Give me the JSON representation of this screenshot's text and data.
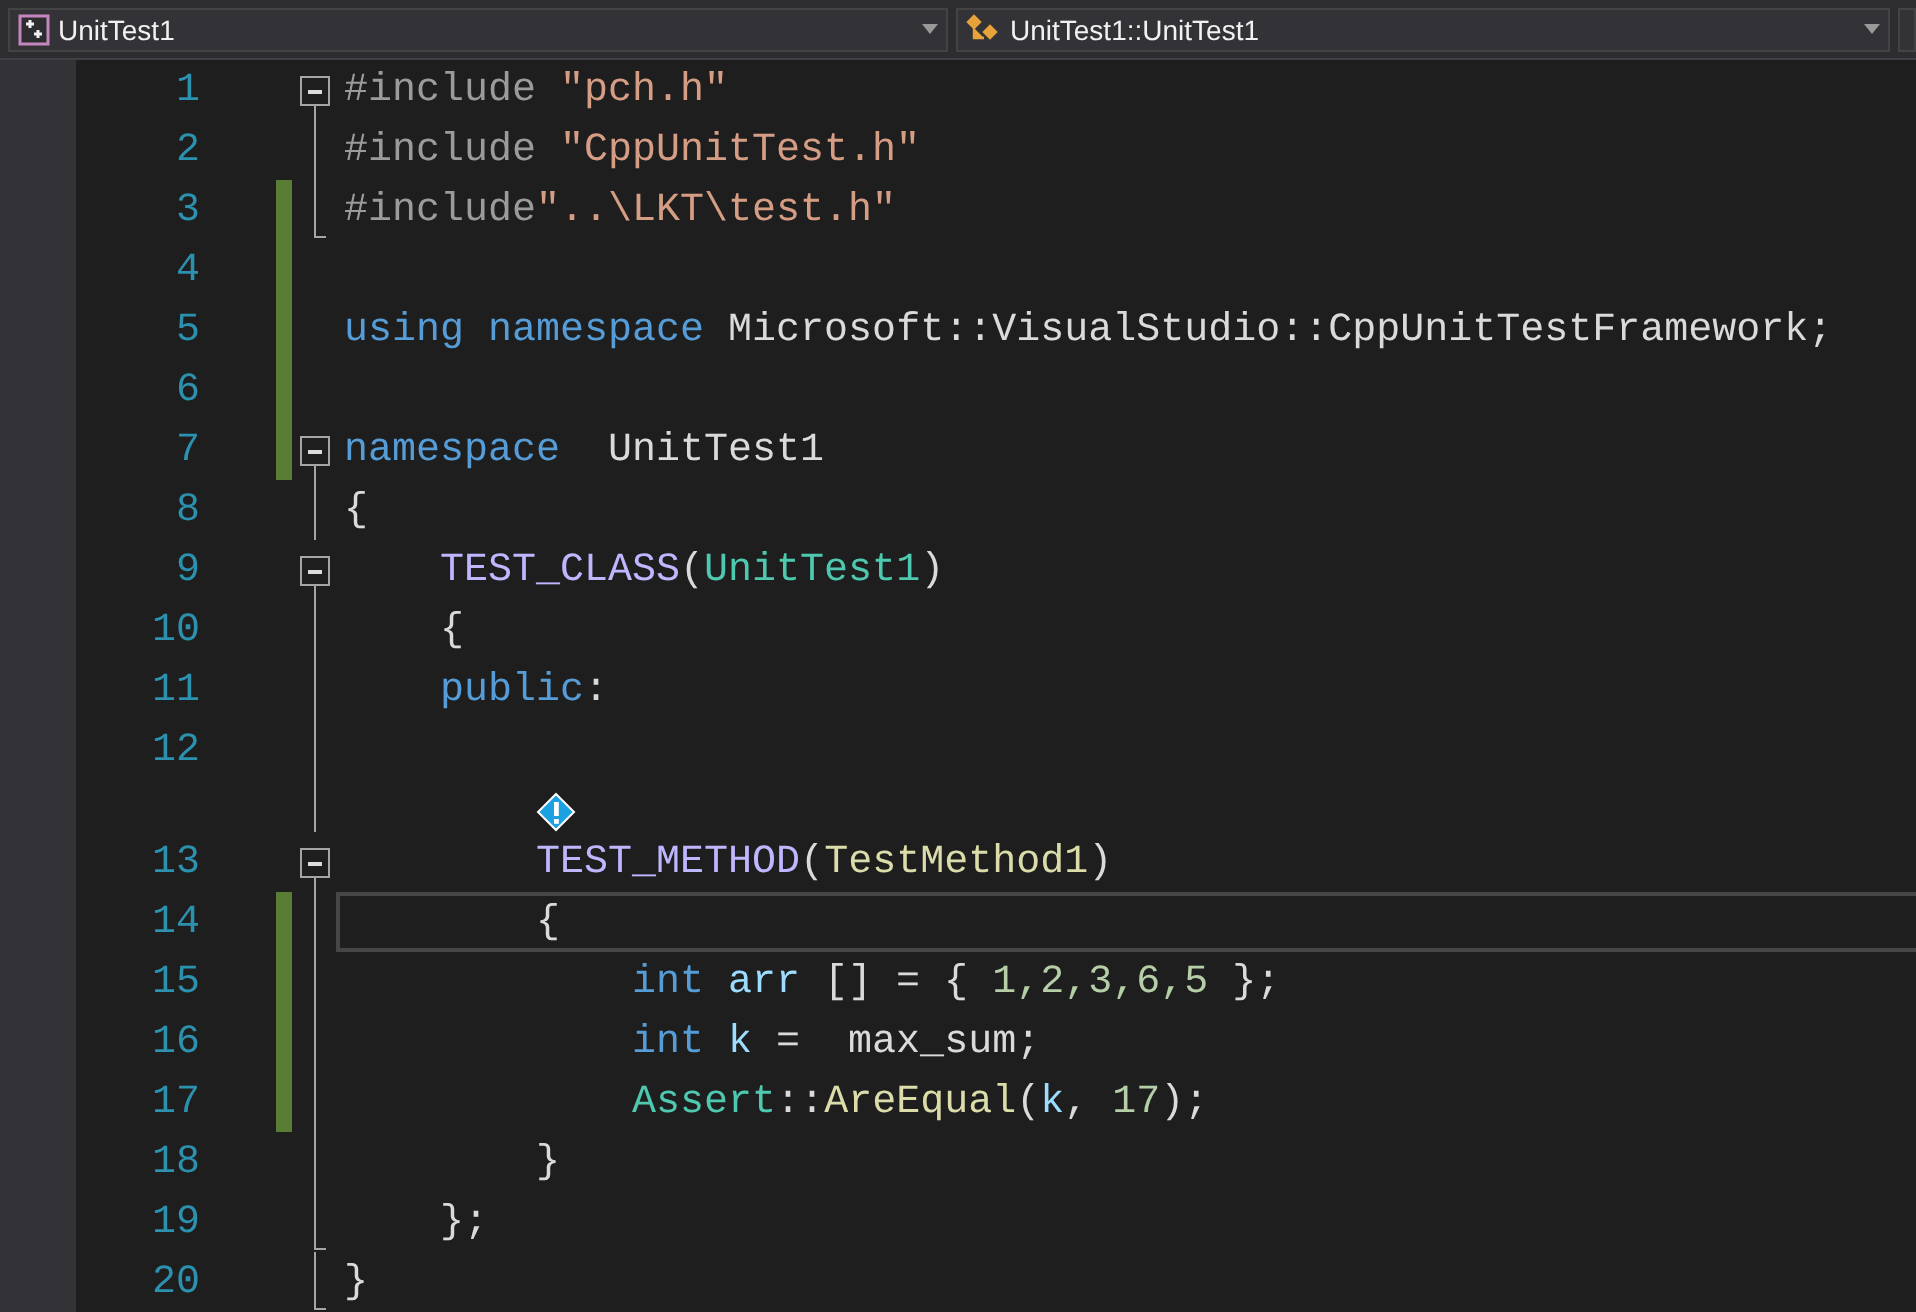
{
  "navbar": {
    "project": "UnitTest1",
    "scope": "UnitTest1::UnitTest1"
  },
  "lines": [
    {
      "number": "1",
      "kind": "start",
      "changed": false,
      "current": false,
      "hint": false,
      "tokens": [
        {
          "kind": "preproc",
          "text": "#include "
        },
        {
          "kind": "string",
          "text": "\"pch.h\""
        }
      ]
    },
    {
      "number": "2",
      "kind": "inside",
      "changed": false,
      "current": false,
      "hint": false,
      "tokens": [
        {
          "kind": "preproc",
          "text": "#include "
        },
        {
          "kind": "string",
          "text": "\"CppUnitTest.h\""
        }
      ]
    },
    {
      "number": "3",
      "kind": "end",
      "changed": true,
      "current": false,
      "hint": false,
      "tokens": [
        {
          "kind": "preproc",
          "text": "#include"
        },
        {
          "kind": "string",
          "text": "\"..\\LKT\\test.h\""
        }
      ]
    },
    {
      "number": "4",
      "kind": "plain",
      "changed": true,
      "current": false,
      "hint": false
    },
    {
      "number": "5",
      "kind": "plain",
      "changed": true,
      "current": false,
      "hint": false,
      "tokens": [
        {
          "kind": "keyword",
          "text": "using "
        },
        {
          "kind": "keyword",
          "text": "namespace"
        },
        {
          "kind": "plain",
          "text": " Microsoft::VisualStudio::CppUnitTestFramework;"
        }
      ]
    },
    {
      "number": "6",
      "kind": "plain",
      "changed": true,
      "current": false,
      "hint": false
    },
    {
      "number": "7",
      "kind": "start",
      "changed": true,
      "current": false,
      "hint": false,
      "tokens": [
        {
          "kind": "keyword",
          "text": "namespace"
        },
        {
          "kind": "plain",
          "text": "  UnitTest1"
        }
      ]
    },
    {
      "number": "8",
      "kind": "inside",
      "changed": false,
      "current": false,
      "hint": false,
      "tokens": [
        {
          "kind": "plain",
          "text": "{"
        }
      ]
    },
    {
      "number": "9",
      "kind": "start",
      "changed": false,
      "current": false,
      "hint": false,
      "tokens": [
        {
          "kind": "macro",
          "text": "    TEST_CLASS"
        },
        {
          "kind": "plain",
          "text": "("
        },
        {
          "kind": "type",
          "text": "UnitTest1"
        },
        {
          "kind": "plain",
          "text": ")"
        }
      ]
    },
    {
      "number": "10",
      "kind": "inside",
      "changed": false,
      "current": false,
      "hint": false,
      "tokens": [
        {
          "kind": "plain",
          "text": "    {"
        }
      ]
    },
    {
      "number": "11",
      "kind": "inside",
      "changed": false,
      "current": false,
      "hint": false,
      "tokens": [
        {
          "kind": "keyword",
          "text": "    public"
        },
        {
          "kind": "plain",
          "text": ":"
        }
      ]
    },
    {
      "number": "12",
      "kind": "inside",
      "changed": false,
      "current": false,
      "hint": false
    },
    {
      "number": "13",
      "kind": "start",
      "changed": false,
      "current": false,
      "hint": true,
      "tokens": [
        {
          "kind": "macro",
          "text": "        TEST_METHOD"
        },
        {
          "kind": "plain",
          "text": "("
        },
        {
          "kind": "function",
          "text": "TestMethod1"
        },
        {
          "kind": "plain",
          "text": ")"
        }
      ]
    },
    {
      "number": "14",
      "kind": "inside",
      "changed": true,
      "current": true,
      "hint": false,
      "tokens": [
        {
          "kind": "plain",
          "text": "        {"
        }
      ]
    },
    {
      "number": "15",
      "kind": "inside",
      "changed": true,
      "current": false,
      "hint": false,
      "tokens": [
        {
          "kind": "keyword",
          "text": "            int "
        },
        {
          "kind": "variable",
          "text": "arr"
        },
        {
          "kind": "plain",
          "text": " [] = { "
        },
        {
          "kind": "number",
          "text": "1,2,3,6,5"
        },
        {
          "kind": "plain",
          "text": " };"
        }
      ]
    },
    {
      "number": "16",
      "kind": "inside",
      "changed": true,
      "current": false,
      "hint": false,
      "tokens": [
        {
          "kind": "keyword",
          "text": "            int "
        },
        {
          "kind": "variable",
          "text": "k"
        },
        {
          "kind": "plain",
          "text": " =  max_sum;"
        }
      ]
    },
    {
      "number": "17",
      "kind": "inside",
      "changed": true,
      "current": false,
      "hint": false,
      "tokens": [
        {
          "kind": "type",
          "text": "            Assert"
        },
        {
          "kind": "plain",
          "text": "::"
        },
        {
          "kind": "function",
          "text": "AreEqual"
        },
        {
          "kind": "plain",
          "text": "("
        },
        {
          "kind": "variable",
          "text": "k"
        },
        {
          "kind": "plain",
          "text": ", "
        },
        {
          "kind": "number",
          "text": "17"
        },
        {
          "kind": "plain",
          "text": ");"
        }
      ]
    },
    {
      "number": "18",
      "kind": "inside",
      "changed": false,
      "current": false,
      "hint": false,
      "tokens": [
        {
          "kind": "plain",
          "text": "        }"
        }
      ]
    },
    {
      "number": "19",
      "kind": "end",
      "changed": false,
      "current": false,
      "hint": false,
      "tokens": [
        {
          "kind": "plain",
          "text": "    };"
        }
      ]
    },
    {
      "number": "20",
      "kind": "end",
      "changed": false,
      "current": false,
      "hint": false,
      "tokens": [
        {
          "kind": "plain",
          "text": "}"
        }
      ]
    }
  ]
}
